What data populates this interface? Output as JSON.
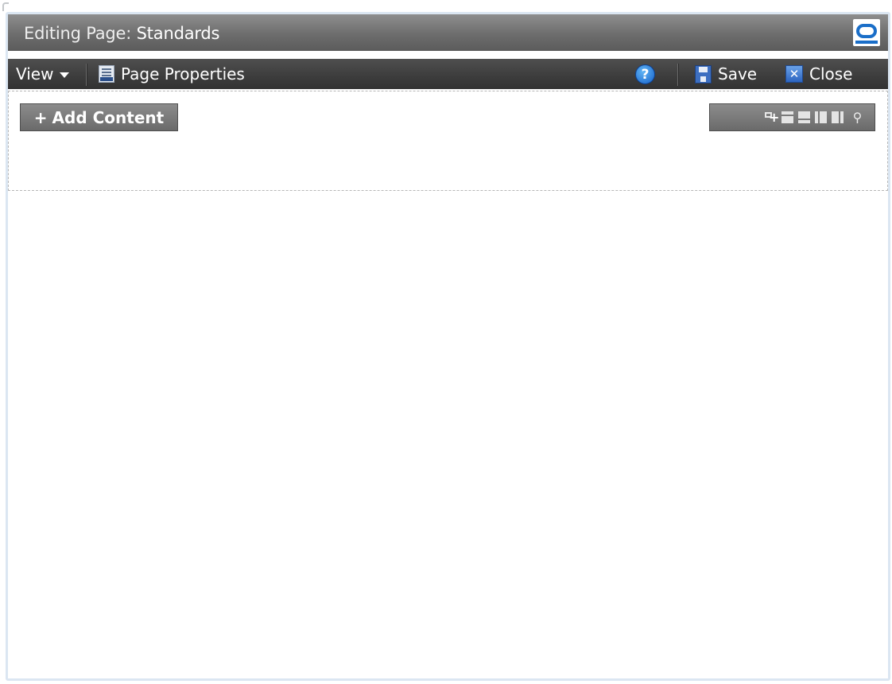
{
  "header": {
    "title_label": "Editing Page:",
    "title_value": "Standards",
    "logo_icon": "oracle-logo-icon"
  },
  "toolbar": {
    "view_label": "View",
    "page_properties_label": "Page Properties",
    "help_icon": "help-icon",
    "help_glyph": "?",
    "save_label": "Save",
    "close_label": "Close"
  },
  "content": {
    "add_content_label": "Add Content",
    "layout_tools": [
      "add-box-icon",
      "layout-top-icon",
      "layout-bottom-icon",
      "layout-left-icon",
      "layout-right-icon",
      "wrench-icon"
    ]
  },
  "colors": {
    "title_bar": "#6d6d6d",
    "toolbar": "#3c3c3c",
    "frame_border": "#dbe6f2",
    "accent_blue": "#1a6ec8"
  }
}
